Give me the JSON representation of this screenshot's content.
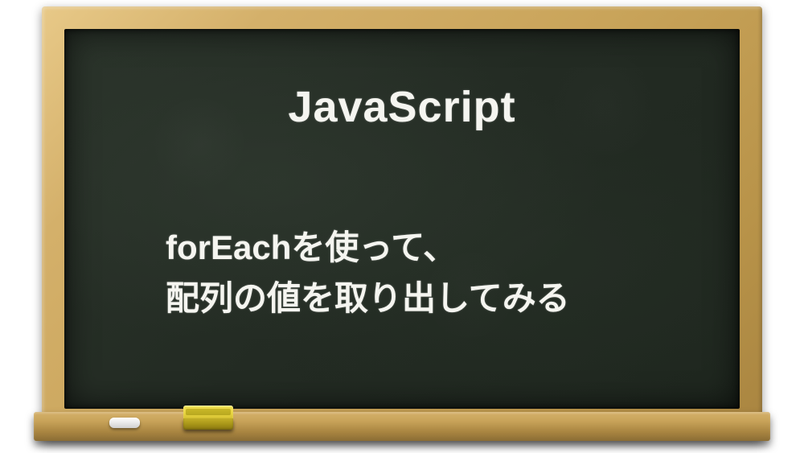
{
  "board": {
    "title": "JavaScript",
    "subtitle": "forEachを使って、\n配列の値を取り出してみる"
  },
  "props": {
    "chalk_color": "#ffffff",
    "eraser_color": "#e8d440"
  },
  "colors": {
    "board_surface": "#2a332a",
    "frame": "#c9a45a",
    "text": "#f5f5f0"
  }
}
